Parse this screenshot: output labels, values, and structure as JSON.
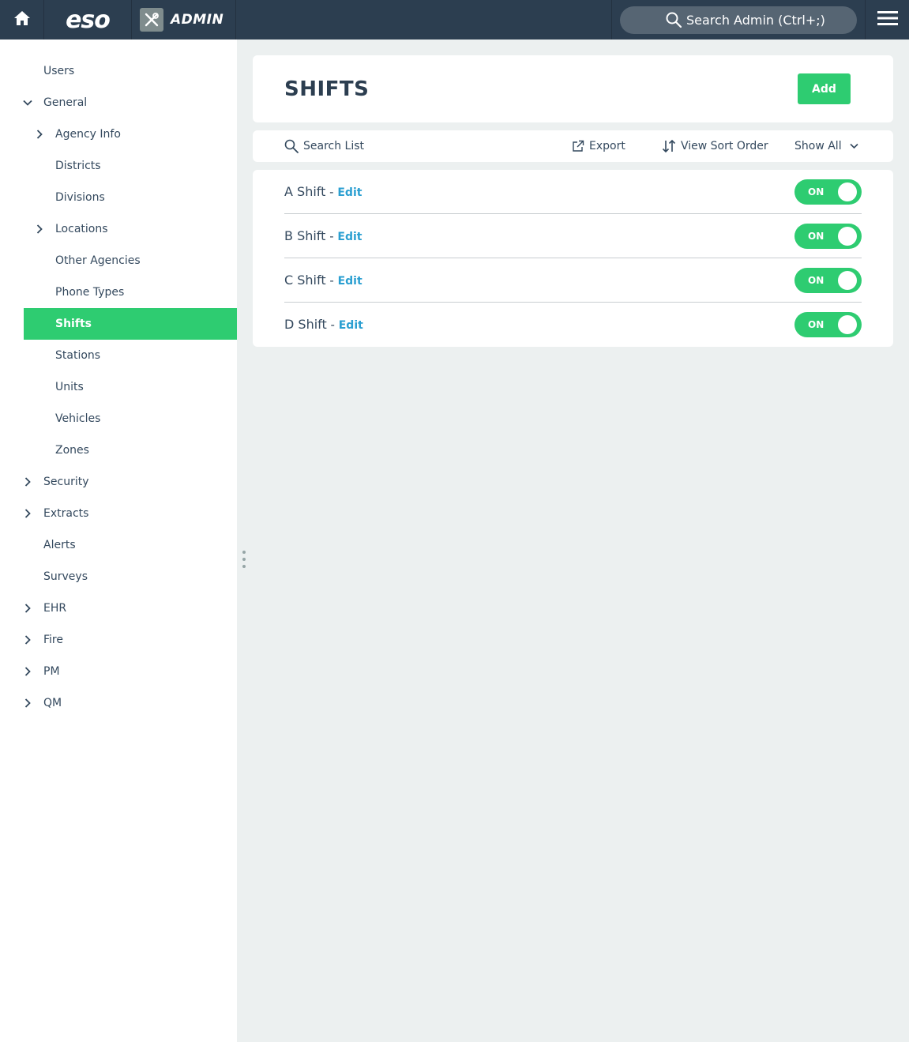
{
  "topbar": {
    "logo": "eso",
    "admin_label": "ADMIN",
    "search_placeholder": "Search Admin (Ctrl+;)"
  },
  "sidebar": {
    "items": [
      {
        "label": "Users",
        "level": 0,
        "chevron": "none"
      },
      {
        "label": "General",
        "level": 0,
        "chevron": "down"
      },
      {
        "label": "Agency Info",
        "level": 1,
        "chevron": "right"
      },
      {
        "label": "Districts",
        "level": 1,
        "chevron": "none"
      },
      {
        "label": "Divisions",
        "level": 1,
        "chevron": "none"
      },
      {
        "label": "Locations",
        "level": 1,
        "chevron": "right"
      },
      {
        "label": "Other Agencies",
        "level": 1,
        "chevron": "none"
      },
      {
        "label": "Phone Types",
        "level": 1,
        "chevron": "none"
      },
      {
        "label": "Shifts",
        "level": 1,
        "chevron": "none",
        "active": true
      },
      {
        "label": "Stations",
        "level": 1,
        "chevron": "none"
      },
      {
        "label": "Units",
        "level": 1,
        "chevron": "none"
      },
      {
        "label": "Vehicles",
        "level": 1,
        "chevron": "none"
      },
      {
        "label": "Zones",
        "level": 1,
        "chevron": "none"
      },
      {
        "label": "Security",
        "level": 0,
        "chevron": "right"
      },
      {
        "label": "Extracts",
        "level": 0,
        "chevron": "right"
      },
      {
        "label": "Alerts",
        "level": 0,
        "chevron": "none"
      },
      {
        "label": "Surveys",
        "level": 0,
        "chevron": "none"
      },
      {
        "label": "EHR",
        "level": 0,
        "chevron": "right"
      },
      {
        "label": "Fire",
        "level": 0,
        "chevron": "right"
      },
      {
        "label": "PM",
        "level": 0,
        "chevron": "right"
      },
      {
        "label": "QM",
        "level": 0,
        "chevron": "right"
      }
    ]
  },
  "main": {
    "title": "SHIFTS",
    "add_label": "Add",
    "toolbar": {
      "search_label": "Search List",
      "export_label": "Export",
      "sort_label": "View Sort Order",
      "filter_label": "Show All"
    },
    "shifts": [
      {
        "name": "A Shift",
        "separator": " - ",
        "edit_label": "Edit",
        "toggle_label": "ON"
      },
      {
        "name": "B Shift",
        "separator": " - ",
        "edit_label": "Edit",
        "toggle_label": "ON"
      },
      {
        "name": "C Shift",
        "separator": " - ",
        "edit_label": "Edit",
        "toggle_label": "ON"
      },
      {
        "name": "D Shift",
        "separator": " - ",
        "edit_label": "Edit",
        "toggle_label": "ON"
      }
    ]
  },
  "colors": {
    "topbar": "#2c3e50",
    "accent": "#2ecc71",
    "link": "#2b9fd1",
    "background": "#ecf0f0"
  }
}
